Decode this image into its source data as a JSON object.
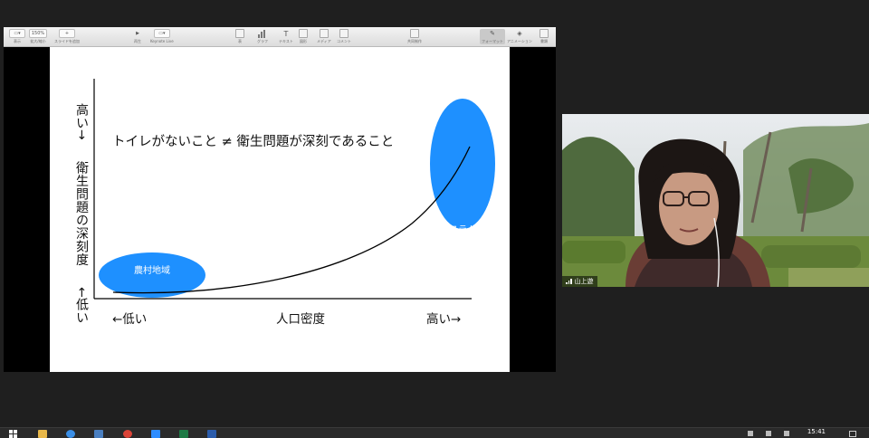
{
  "toolbar": {
    "items": [
      {
        "label": "表示",
        "glyph": ""
      },
      {
        "label": "拡大/縮小",
        "glyph": "150%"
      },
      {
        "label": "スライドを追加",
        "glyph": "+"
      },
      {
        "label": "再生",
        "glyph": "▶"
      },
      {
        "label": "Keynote Live",
        "glyph": ""
      },
      {
        "label": "表",
        "glyph": ""
      },
      {
        "label": "グラフ",
        "glyph": ""
      },
      {
        "label": "テキスト",
        "glyph": "T"
      },
      {
        "label": "図形",
        "glyph": ""
      },
      {
        "label": "メディア",
        "glyph": ""
      },
      {
        "label": "コメント",
        "glyph": ""
      },
      {
        "label": "共同制作",
        "glyph": ""
      },
      {
        "label": "フォーマット",
        "glyph": ""
      },
      {
        "label": "アニメーション",
        "glyph": ""
      },
      {
        "label": "書類",
        "glyph": ""
      }
    ]
  },
  "slide": {
    "title": "トイレがないこと ≠ 衛生問題が深刻であること",
    "y_axis": {
      "low": "←低い",
      "label": "衛生問題の深刻度",
      "high": "高い→"
    },
    "x_axis": {
      "low": "←低い",
      "label": "人口密度",
      "high": "高い→"
    },
    "rural_label": "農村地域",
    "slum_label_1": "スラム",
    "slum_label_2": "地域",
    "ellipse_color": "#1e90ff"
  },
  "video": {
    "participant_name": "山上遊"
  },
  "taskbar": {
    "time": "15:41"
  }
}
